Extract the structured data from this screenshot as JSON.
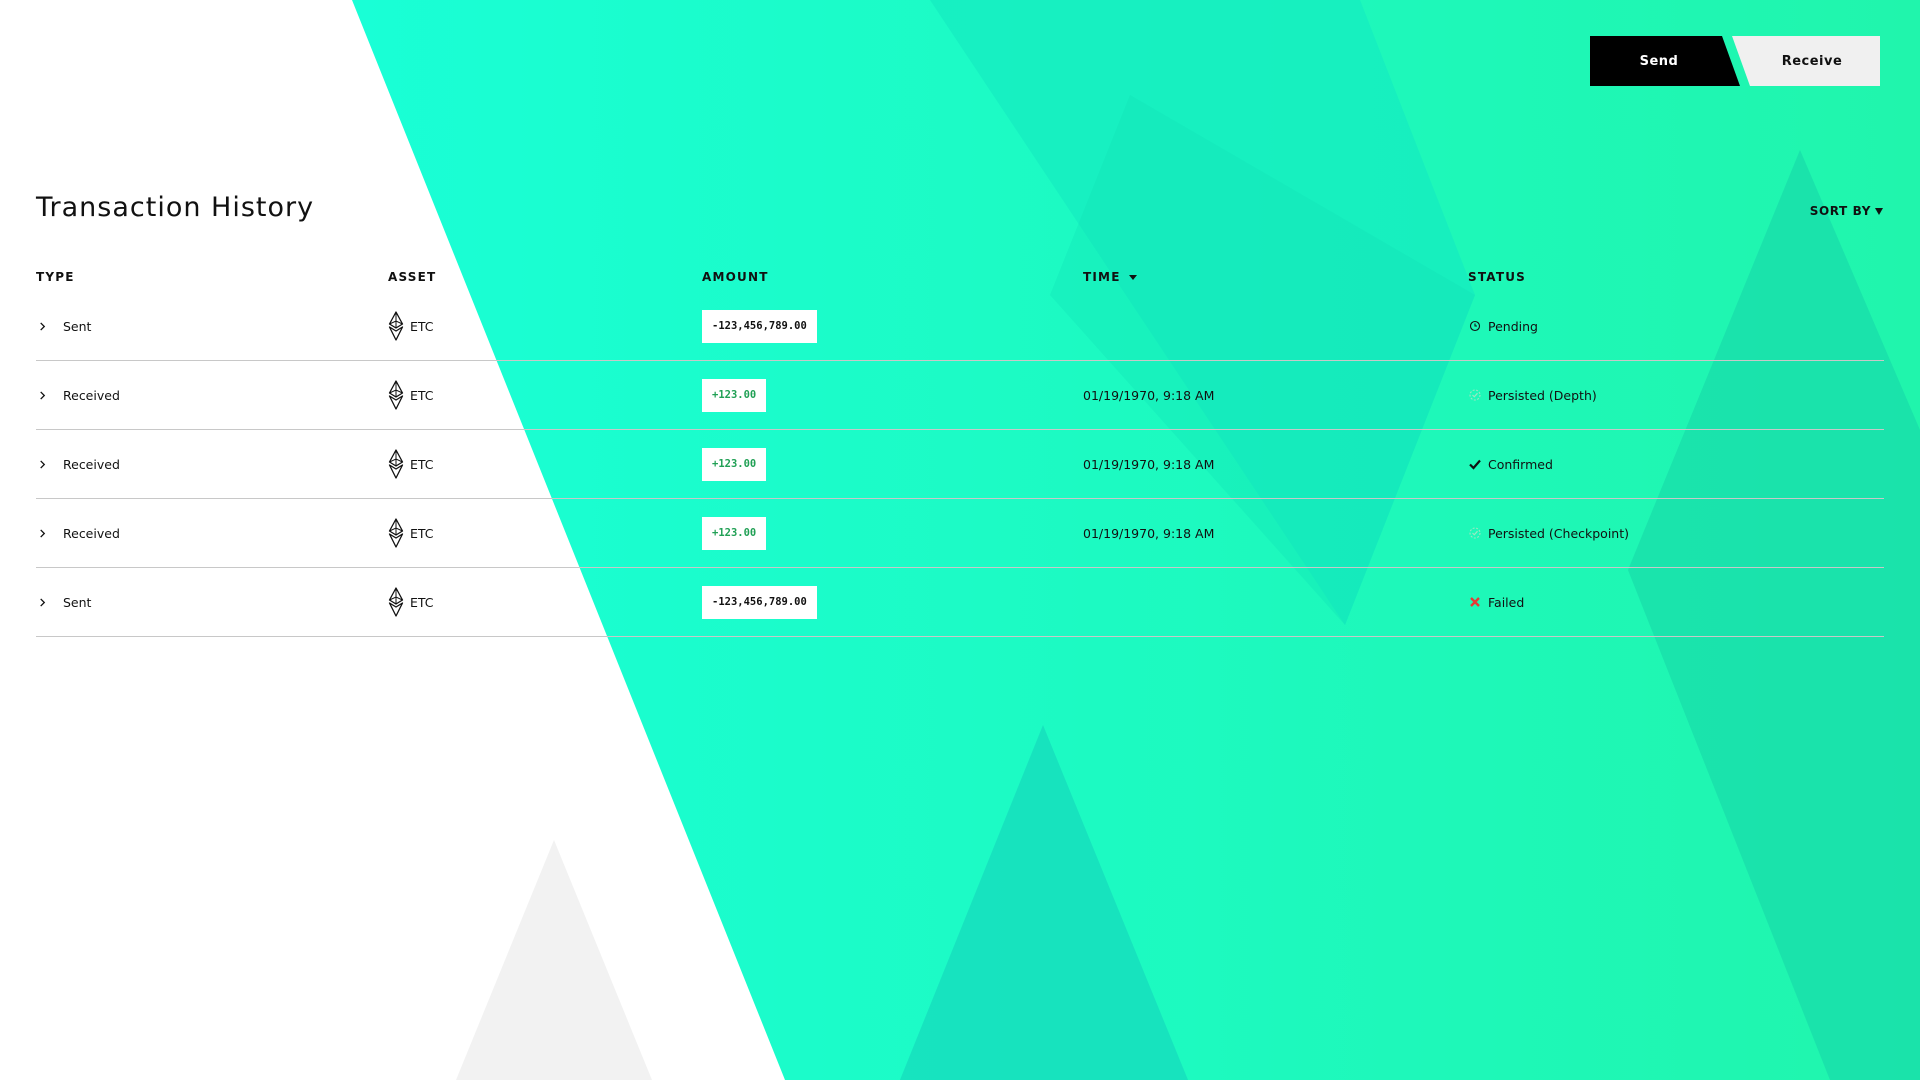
{
  "actions": {
    "send_label": "Send",
    "receive_label": "Receive"
  },
  "page_title": "Transaction History",
  "sort_by_label": "SORT BY",
  "table": {
    "headers": {
      "type": "TYPE",
      "asset": "ASSET",
      "amount": "AMOUNT",
      "time": "TIME",
      "status": "STATUS"
    },
    "rows": [
      {
        "type": "Sent",
        "asset": "ETC",
        "amount": "-123,456,789.00",
        "time": "",
        "status": "Pending",
        "status_icon": "clock-icon"
      },
      {
        "type": "Received",
        "asset": "ETC",
        "amount": "+123.00",
        "time": "01/19/1970, 9:18 AM",
        "status": "Persisted (Depth)",
        "status_icon": "persisted-check-icon"
      },
      {
        "type": "Received",
        "asset": "ETC",
        "amount": "+123.00",
        "time": "01/19/1970, 9:18 AM",
        "status": "Confirmed",
        "status_icon": "check-icon"
      },
      {
        "type": "Received",
        "asset": "ETC",
        "amount": "+123.00",
        "time": "01/19/1970, 9:18 AM",
        "status": "Persisted (Checkpoint)",
        "status_icon": "persisted-check-icon"
      },
      {
        "type": "Sent",
        "asset": "ETC",
        "amount": "-123,456,789.00",
        "time": "",
        "status": "Failed",
        "status_icon": "x-icon"
      }
    ]
  },
  "colors": {
    "accent": "#1dffd3",
    "accent_shade": "#1ae6bd",
    "positive": "#21a055",
    "failed": "#e53935",
    "persisted_icon": "#9be7c2"
  }
}
